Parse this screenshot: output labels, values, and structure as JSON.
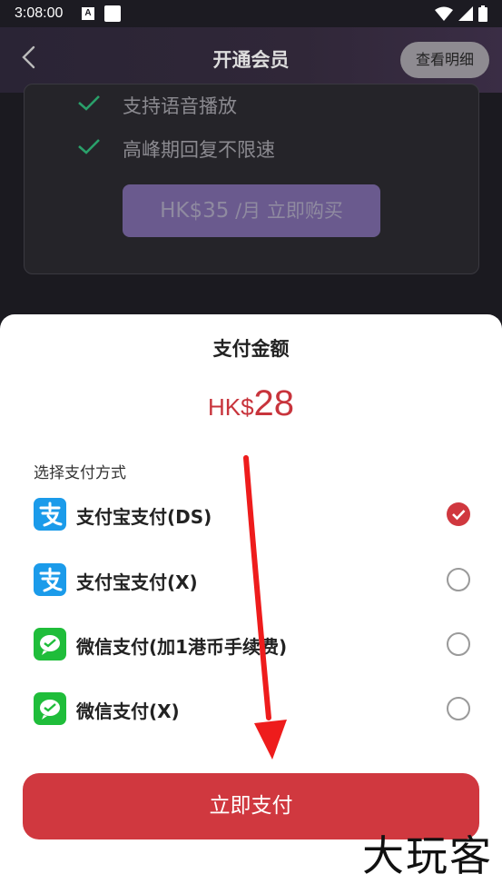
{
  "status_bar": {
    "time": "3:08:00",
    "a_label": "A"
  },
  "header": {
    "title": "开通会员",
    "detail_label": "查看明细"
  },
  "membership_card": {
    "features": [
      "支持语音播放",
      "高峰期回复不限速"
    ],
    "buy_button": {
      "amount": "HK$35",
      "suffix": "/月 立即购买"
    }
  },
  "payment_sheet": {
    "title": "支付金额",
    "currency": "HK$",
    "amount": "28",
    "section_label": "选择支付方式",
    "methods": [
      {
        "label": "支付宝支付(DS)",
        "icon": "alipay-icon",
        "selected": true
      },
      {
        "label": "支付宝支付(X)",
        "icon": "alipay-icon",
        "selected": false
      },
      {
        "label": "微信支付(加1港币手续费)",
        "icon": "wechat-pay-icon",
        "selected": false
      },
      {
        "label": "微信支付(X)",
        "icon": "wechat-pay-icon",
        "selected": false
      }
    ],
    "pay_button": "立即支付"
  },
  "watermark": "大玩客",
  "colors": {
    "accent": "#d0383f",
    "alipay": "#1b9bea",
    "wechat": "#1fbd3a",
    "purple": "#6a5a8e"
  }
}
